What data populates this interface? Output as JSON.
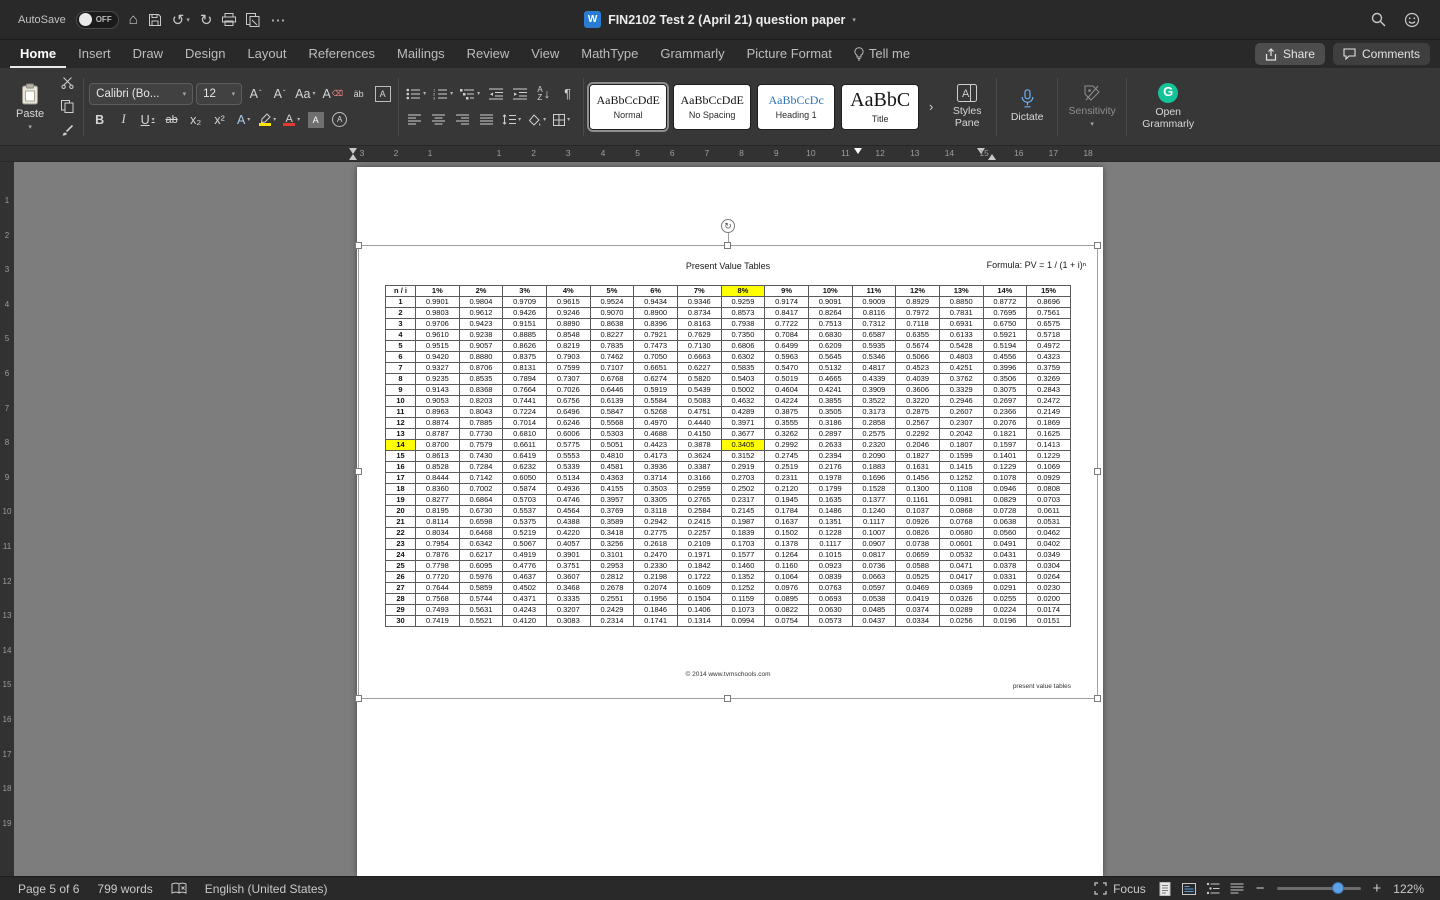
{
  "titlebar": {
    "autosave_label": "AutoSave",
    "autosave_state": "OFF",
    "doc_title": "FIN2102 Test 2 (April 21) question paper"
  },
  "tabs": {
    "items": [
      {
        "label": "Home",
        "active": true
      },
      {
        "label": "Insert",
        "active": false
      },
      {
        "label": "Draw",
        "active": false
      },
      {
        "label": "Design",
        "active": false
      },
      {
        "label": "Layout",
        "active": false
      },
      {
        "label": "References",
        "active": false
      },
      {
        "label": "Mailings",
        "active": false
      },
      {
        "label": "Review",
        "active": false
      },
      {
        "label": "View",
        "active": false
      },
      {
        "label": "MathType",
        "active": false
      },
      {
        "label": "Grammarly",
        "active": false
      },
      {
        "label": "Picture Format",
        "active": false
      },
      {
        "label": "Tell me",
        "active": false,
        "icon": "bulb"
      }
    ],
    "share": "Share",
    "comments": "Comments"
  },
  "ribbon": {
    "paste": "Paste",
    "font_name": "Calibri (Bo...",
    "font_size": "12",
    "styles_gallery": [
      {
        "sample": "AaBbCcDdE",
        "label": "Normal"
      },
      {
        "sample": "AaBbCcDdE",
        "label": "No Spacing"
      },
      {
        "sample": "AaBbCcDc",
        "label": "Heading 1"
      },
      {
        "sample": "AaBbC",
        "label": "Title"
      }
    ],
    "styles_pane": "Styles Pane",
    "dictate": "Dictate",
    "sensitivity": "Sensitivity",
    "grammarly": "Open Grammarly"
  },
  "ruler": {
    "h_left": [
      "3",
      "2",
      "1"
    ],
    "h_main": [
      "1",
      "2",
      "3",
      "4",
      "5",
      "6",
      "7",
      "8",
      "9",
      "10",
      "11",
      "12",
      "13",
      "14",
      "15",
      "16",
      "17",
      "18"
    ],
    "v": [
      "1",
      "2",
      "3",
      "4",
      "5",
      "6",
      "7",
      "8",
      "9",
      "10",
      "11",
      "12",
      "13",
      "14",
      "15",
      "16",
      "17",
      "18",
      "19"
    ]
  },
  "document": {
    "title": "Present Value Tables",
    "formula": "Formula: PV = 1 / (1 + i)ⁿ",
    "footer_center": "© 2014 www.tvmschools.com",
    "footer_right": "present value tables",
    "table": {
      "header": [
        "n / i",
        "1%",
        "2%",
        "3%",
        "4%",
        "5%",
        "6%",
        "7%",
        "8%",
        "9%",
        "10%",
        "11%",
        "12%",
        "13%",
        "14%",
        "15%"
      ],
      "highlight_col": 8,
      "highlight_row": "14",
      "rows": [
        [
          "1",
          "0.9901",
          "0.9804",
          "0.9709",
          "0.9615",
          "0.9524",
          "0.9434",
          "0.9346",
          "0.9259",
          "0.9174",
          "0.9091",
          "0.9009",
          "0.8929",
          "0.8850",
          "0.8772",
          "0.8696"
        ],
        [
          "2",
          "0.9803",
          "0.9612",
          "0.9426",
          "0.9246",
          "0.9070",
          "0.8900",
          "0.8734",
          "0.8573",
          "0.8417",
          "0.8264",
          "0.8116",
          "0.7972",
          "0.7831",
          "0.7695",
          "0.7561"
        ],
        [
          "3",
          "0.9706",
          "0.9423",
          "0.9151",
          "0.8890",
          "0.8638",
          "0.8396",
          "0.8163",
          "0.7938",
          "0.7722",
          "0.7513",
          "0.7312",
          "0.7118",
          "0.6931",
          "0.6750",
          "0.6575"
        ],
        [
          "4",
          "0.9610",
          "0.9238",
          "0.8885",
          "0.8548",
          "0.8227",
          "0.7921",
          "0.7629",
          "0.7350",
          "0.7084",
          "0.6830",
          "0.6587",
          "0.6355",
          "0.6133",
          "0.5921",
          "0.5718"
        ],
        [
          "5",
          "0.9515",
          "0.9057",
          "0.8626",
          "0.8219",
          "0.7835",
          "0.7473",
          "0.7130",
          "0.6806",
          "0.6499",
          "0.6209",
          "0.5935",
          "0.5674",
          "0.5428",
          "0.5194",
          "0.4972"
        ],
        [
          "6",
          "0.9420",
          "0.8880",
          "0.8375",
          "0.7903",
          "0.7462",
          "0.7050",
          "0.6663",
          "0.6302",
          "0.5963",
          "0.5645",
          "0.5346",
          "0.5066",
          "0.4803",
          "0.4556",
          "0.4323"
        ],
        [
          "7",
          "0.9327",
          "0.8706",
          "0.8131",
          "0.7599",
          "0.7107",
          "0.6651",
          "0.6227",
          "0.5835",
          "0.5470",
          "0.5132",
          "0.4817",
          "0.4523",
          "0.4251",
          "0.3996",
          "0.3759"
        ],
        [
          "8",
          "0.9235",
          "0.8535",
          "0.7894",
          "0.7307",
          "0.6768",
          "0.6274",
          "0.5820",
          "0.5403",
          "0.5019",
          "0.4665",
          "0.4339",
          "0.4039",
          "0.3762",
          "0.3506",
          "0.3269"
        ],
        [
          "9",
          "0.9143",
          "0.8368",
          "0.7664",
          "0.7026",
          "0.6446",
          "0.5919",
          "0.5439",
          "0.5002",
          "0.4604",
          "0.4241",
          "0.3909",
          "0.3606",
          "0.3329",
          "0.3075",
          "0.2843"
        ],
        [
          "10",
          "0.9053",
          "0.8203",
          "0.7441",
          "0.6756",
          "0.6139",
          "0.5584",
          "0.5083",
          "0.4632",
          "0.4224",
          "0.3855",
          "0.3522",
          "0.3220",
          "0.2946",
          "0.2697",
          "0.2472"
        ],
        [
          "11",
          "0.8963",
          "0.8043",
          "0.7224",
          "0.6496",
          "0.5847",
          "0.5268",
          "0.4751",
          "0.4289",
          "0.3875",
          "0.3505",
          "0.3173",
          "0.2875",
          "0.2607",
          "0.2366",
          "0.2149"
        ],
        [
          "12",
          "0.8874",
          "0.7885",
          "0.7014",
          "0.6246",
          "0.5568",
          "0.4970",
          "0.4440",
          "0.3971",
          "0.3555",
          "0.3186",
          "0.2858",
          "0.2567",
          "0.2307",
          "0.2076",
          "0.1869"
        ],
        [
          "13",
          "0.8787",
          "0.7730",
          "0.6810",
          "0.6006",
          "0.5303",
          "0.4688",
          "0.4150",
          "0.3677",
          "0.3262",
          "0.2897",
          "0.2575",
          "0.2292",
          "0.2042",
          "0.1821",
          "0.1625"
        ],
        [
          "14",
          "0.8700",
          "0.7579",
          "0.6611",
          "0.5775",
          "0.5051",
          "0.4423",
          "0.3878",
          "0.3405",
          "0.2992",
          "0.2633",
          "0.2320",
          "0.2046",
          "0.1807",
          "0.1597",
          "0.1413"
        ],
        [
          "15",
          "0.8613",
          "0.7430",
          "0.6419",
          "0.5553",
          "0.4810",
          "0.4173",
          "0.3624",
          "0.3152",
          "0.2745",
          "0.2394",
          "0.2090",
          "0.1827",
          "0.1599",
          "0.1401",
          "0.1229"
        ],
        [
          "16",
          "0.8528",
          "0.7284",
          "0.6232",
          "0.5339",
          "0.4581",
          "0.3936",
          "0.3387",
          "0.2919",
          "0.2519",
          "0.2176",
          "0.1883",
          "0.1631",
          "0.1415",
          "0.1229",
          "0.1069"
        ],
        [
          "17",
          "0.8444",
          "0.7142",
          "0.6050",
          "0.5134",
          "0.4363",
          "0.3714",
          "0.3166",
          "0.2703",
          "0.2311",
          "0.1978",
          "0.1696",
          "0.1456",
          "0.1252",
          "0.1078",
          "0.0929"
        ],
        [
          "18",
          "0.8360",
          "0.7002",
          "0.5874",
          "0.4936",
          "0.4155",
          "0.3503",
          "0.2959",
          "0.2502",
          "0.2120",
          "0.1799",
          "0.1528",
          "0.1300",
          "0.1108",
          "0.0946",
          "0.0808"
        ],
        [
          "19",
          "0.8277",
          "0.6864",
          "0.5703",
          "0.4746",
          "0.3957",
          "0.3305",
          "0.2765",
          "0.2317",
          "0.1945",
          "0.1635",
          "0.1377",
          "0.1161",
          "0.0981",
          "0.0829",
          "0.0703"
        ],
        [
          "20",
          "0.8195",
          "0.6730",
          "0.5537",
          "0.4564",
          "0.3769",
          "0.3118",
          "0.2584",
          "0.2145",
          "0.1784",
          "0.1486",
          "0.1240",
          "0.1037",
          "0.0868",
          "0.0728",
          "0.0611"
        ],
        [
          "21",
          "0.8114",
          "0.6598",
          "0.5375",
          "0.4388",
          "0.3589",
          "0.2942",
          "0.2415",
          "0.1987",
          "0.1637",
          "0.1351",
          "0.1117",
          "0.0926",
          "0.0768",
          "0.0638",
          "0.0531"
        ],
        [
          "22",
          "0.8034",
          "0.6468",
          "0.5219",
          "0.4220",
          "0.3418",
          "0.2775",
          "0.2257",
          "0.1839",
          "0.1502",
          "0.1228",
          "0.1007",
          "0.0826",
          "0.0680",
          "0.0560",
          "0.0462"
        ],
        [
          "23",
          "0.7954",
          "0.6342",
          "0.5067",
          "0.4057",
          "0.3256",
          "0.2618",
          "0.2109",
          "0.1703",
          "0.1378",
          "0.1117",
          "0.0907",
          "0.0738",
          "0.0601",
          "0.0491",
          "0.0402"
        ],
        [
          "24",
          "0.7876",
          "0.6217",
          "0.4919",
          "0.3901",
          "0.3101",
          "0.2470",
          "0.1971",
          "0.1577",
          "0.1264",
          "0.1015",
          "0.0817",
          "0.0659",
          "0.0532",
          "0.0431",
          "0.0349"
        ],
        [
          "25",
          "0.7798",
          "0.6095",
          "0.4776",
          "0.3751",
          "0.2953",
          "0.2330",
          "0.1842",
          "0.1460",
          "0.1160",
          "0.0923",
          "0.0736",
          "0.0588",
          "0.0471",
          "0.0378",
          "0.0304"
        ],
        [
          "26",
          "0.7720",
          "0.5976",
          "0.4637",
          "0.3607",
          "0.2812",
          "0.2198",
          "0.1722",
          "0.1352",
          "0.1064",
          "0.0839",
          "0.0663",
          "0.0525",
          "0.0417",
          "0.0331",
          "0.0264"
        ],
        [
          "27",
          "0.7644",
          "0.5859",
          "0.4502",
          "0.3468",
          "0.2678",
          "0.2074",
          "0.1609",
          "0.1252",
          "0.0976",
          "0.0763",
          "0.0597",
          "0.0469",
          "0.0369",
          "0.0291",
          "0.0230"
        ],
        [
          "28",
          "0.7568",
          "0.5744",
          "0.4371",
          "0.3335",
          "0.2551",
          "0.1956",
          "0.1504",
          "0.1159",
          "0.0895",
          "0.0693",
          "0.0538",
          "0.0419",
          "0.0326",
          "0.0255",
          "0.0200"
        ],
        [
          "29",
          "0.7493",
          "0.5631",
          "0.4243",
          "0.3207",
          "0.2429",
          "0.1846",
          "0.1406",
          "0.1073",
          "0.0822",
          "0.0630",
          "0.0485",
          "0.0374",
          "0.0289",
          "0.0224",
          "0.0174"
        ],
        [
          "30",
          "0.7419",
          "0.5521",
          "0.4120",
          "0.3083",
          "0.2314",
          "0.1741",
          "0.1314",
          "0.0994",
          "0.0754",
          "0.0573",
          "0.0437",
          "0.0334",
          "0.0256",
          "0.0196",
          "0.0151"
        ]
      ]
    }
  },
  "statusbar": {
    "page": "Page 5 of 6",
    "words": "799 words",
    "language": "English (United States)",
    "focus": "Focus",
    "zoom": "122%"
  }
}
